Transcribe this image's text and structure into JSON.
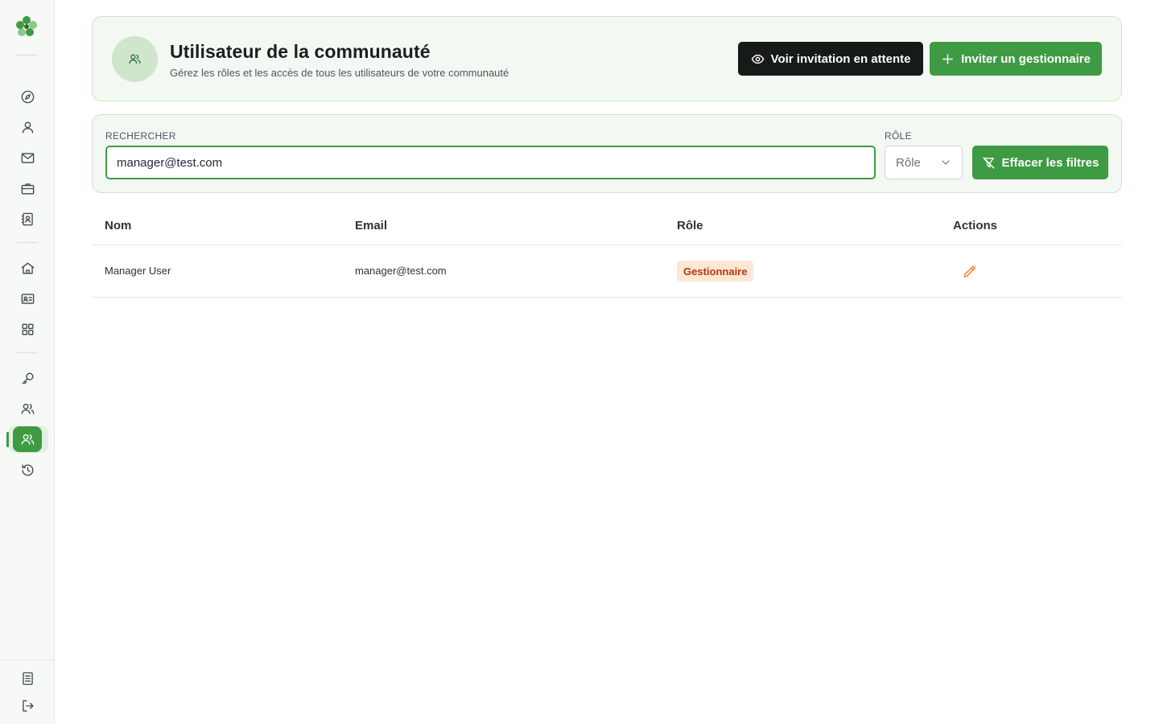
{
  "header": {
    "title": "Utilisateur de la communauté",
    "subtitle": "Gérez les rôles et les accès de tous les utilisateurs de votre communauté",
    "pending_invites_label": "Voir invitation en attente",
    "invite_manager_label": "Inviter un gestionnaire"
  },
  "filters": {
    "search_label": "RECHERCHER",
    "search_value": "manager@test.com",
    "role_label": "RÔLE",
    "role_placeholder": "Rôle",
    "clear_label": "Effacer les filtres"
  },
  "table": {
    "columns": [
      "Nom",
      "Email",
      "Rôle",
      "Actions"
    ],
    "rows": [
      {
        "name": "Manager User",
        "email": "manager@test.com",
        "role": "Gestionnaire"
      }
    ]
  },
  "sidebar": {
    "items": [
      {
        "icon": "compass-icon"
      },
      {
        "icon": "user-icon"
      },
      {
        "icon": "mail-icon"
      },
      {
        "icon": "briefcase-icon"
      },
      {
        "icon": "contact-book-icon"
      },
      {
        "icon": "home-icon"
      },
      {
        "icon": "id-card-icon"
      },
      {
        "icon": "grid-icon"
      },
      {
        "icon": "key-icon"
      },
      {
        "icon": "users-icon"
      },
      {
        "icon": "community-users-icon",
        "active": true
      },
      {
        "icon": "history-icon"
      }
    ],
    "bottom": [
      {
        "icon": "document-icon"
      },
      {
        "icon": "logout-icon"
      }
    ]
  },
  "colors": {
    "brand_green": "#3f9a44",
    "dark_button": "#161a18",
    "badge_bg": "#fde6d3",
    "badge_text": "#b23a0e",
    "card_bg": "#f3f9f2",
    "edit_icon": "#ea7a2c"
  }
}
